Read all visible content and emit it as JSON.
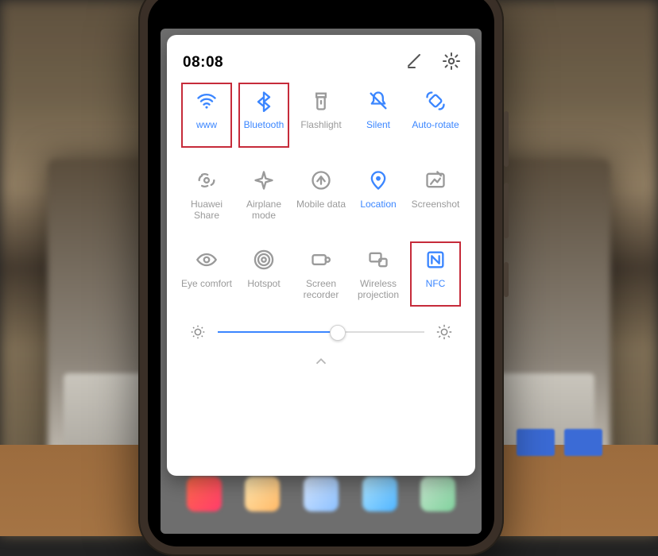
{
  "status": {
    "time": "08:08"
  },
  "header": {
    "edit_icon": "edit-icon",
    "settings_icon": "settings-icon"
  },
  "tiles": [
    {
      "id": "wifi",
      "label": "www",
      "state": "blue",
      "icon": "wifi-icon",
      "highlight": true
    },
    {
      "id": "bluetooth",
      "label": "Bluetooth",
      "state": "blue",
      "icon": "bluetooth-icon",
      "highlight": true
    },
    {
      "id": "flashlight",
      "label": "Flashlight",
      "state": "grey",
      "icon": "flashlight-icon",
      "highlight": false
    },
    {
      "id": "silent",
      "label": "Silent",
      "state": "blue",
      "icon": "silent-icon",
      "highlight": false
    },
    {
      "id": "autorotate",
      "label": "Auto-rotate",
      "state": "blue",
      "icon": "rotate-icon",
      "highlight": false
    },
    {
      "id": "huaweishare",
      "label": "Huawei Share",
      "state": "grey",
      "icon": "share-icon",
      "highlight": false
    },
    {
      "id": "airplane",
      "label": "Airplane mode",
      "state": "grey",
      "icon": "airplane-icon",
      "highlight": false
    },
    {
      "id": "mobiledata",
      "label": "Mobile data",
      "state": "grey",
      "icon": "mobiledata-icon",
      "highlight": false
    },
    {
      "id": "location",
      "label": "Location",
      "state": "blue",
      "icon": "location-icon",
      "highlight": false
    },
    {
      "id": "screenshot",
      "label": "Screenshot",
      "state": "grey",
      "icon": "screenshot-icon",
      "highlight": false
    },
    {
      "id": "eyecomfort",
      "label": "Eye comfort",
      "state": "grey",
      "icon": "eye-icon",
      "highlight": false
    },
    {
      "id": "hotspot",
      "label": "Hotspot",
      "state": "grey",
      "icon": "hotspot-icon",
      "highlight": false
    },
    {
      "id": "recorder",
      "label": "Screen\nrecorder",
      "state": "grey",
      "icon": "recorder-icon",
      "highlight": false
    },
    {
      "id": "projection",
      "label": "Wireless\nprojection",
      "state": "grey",
      "icon": "projection-icon",
      "highlight": false
    },
    {
      "id": "nfc",
      "label": "NFC",
      "state": "blue",
      "icon": "nfc-icon",
      "highlight": true
    }
  ],
  "brightness": {
    "percent": 58
  },
  "colors": {
    "accent": "#3b86ff",
    "inactive": "#9a9a9a",
    "highlight": "#c62b3a"
  }
}
